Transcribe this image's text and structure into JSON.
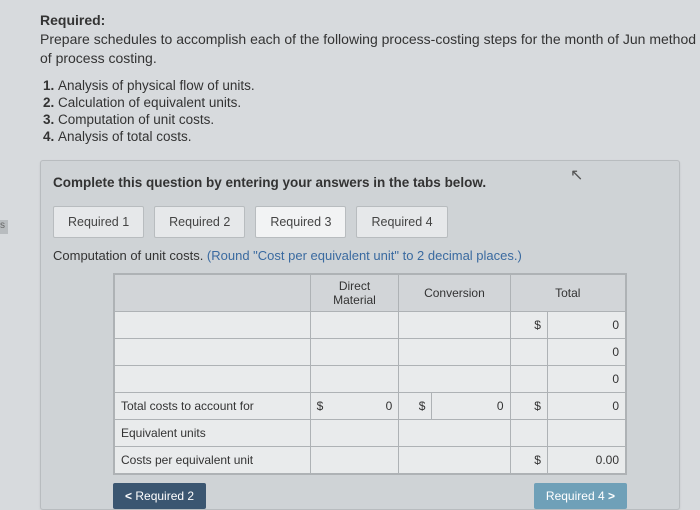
{
  "header": {
    "required_label": "Required:",
    "required_text": "Prepare schedules to accomplish each of the following process-costing steps for the month of Jun method of process costing."
  },
  "steps": [
    "Analysis of physical flow of units.",
    "Calculation of equivalent units.",
    "Computation of unit costs.",
    "Analysis of total costs."
  ],
  "panel": {
    "instruction": "Complete this question by entering your answers in the tabs below.",
    "tabs": [
      "Required 1",
      "Required 2",
      "Required 3",
      "Required 4"
    ],
    "active_tab": "Required 3",
    "sub_instruction_main": "Computation of unit costs. ",
    "sub_instruction_hint": "(Round \"Cost per equivalent unit\" to 2 decimal places.)"
  },
  "table": {
    "headers": {
      "col1": "",
      "direct_material": "Direct Material",
      "conversion": "Conversion",
      "total": "Total"
    },
    "rows_top": [
      {
        "label": "",
        "dm": "",
        "cv": "",
        "tcur": "$",
        "tval": "0"
      },
      {
        "label": "",
        "dm": "",
        "cv": "",
        "tcur": "",
        "tval": "0"
      },
      {
        "label": "",
        "dm": "",
        "cv": "",
        "tcur": "",
        "tval": "0"
      }
    ],
    "rows_bottom": [
      {
        "label": "Total costs to account for",
        "dmcur": "$",
        "dm": "0",
        "cvcur": "$",
        "cv": "0",
        "tcur": "$",
        "tval": "0"
      },
      {
        "label": "Equivalent units",
        "dmcur": "",
        "dm": "",
        "cvcur": "",
        "cv": "",
        "tcur": "",
        "tval": ""
      },
      {
        "label": "Costs per equivalent unit",
        "dmcur": "",
        "dm": "",
        "cvcur": "",
        "cv": "",
        "tcur": "$",
        "tval": "0.00"
      }
    ]
  },
  "nav": {
    "prev_label": "Required 2",
    "next_label": "Required 4",
    "lt": "<",
    "gt": ">"
  },
  "side_marker": "s"
}
